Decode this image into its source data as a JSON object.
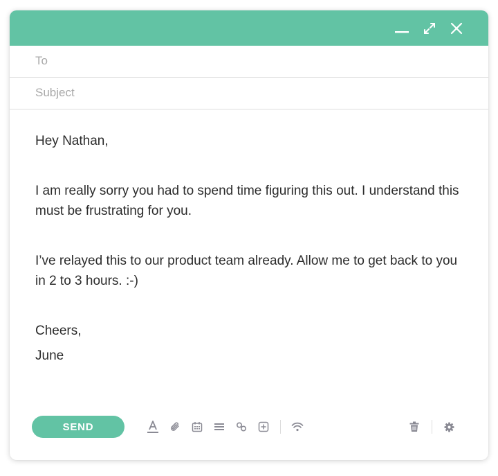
{
  "compose": {
    "to_placeholder": "To",
    "subject_placeholder": "Subject",
    "body": {
      "greeting": "Hey Nathan,",
      "paragraph_1": "I am really sorry you had to spend time figuring this out. I understand this must be frustrating for you.",
      "paragraph_2": "I’ve relayed this to our product team already. Allow me to get back to you in 2 to 3 hours. :-)",
      "signoff": "Cheers,",
      "signature": "June"
    }
  },
  "toolbar": {
    "send_label": "SEND",
    "icons": [
      "text-format-icon",
      "attachment-icon",
      "calendar-icon",
      "list-icon",
      "link-icon",
      "insert-icon",
      "signal-icon",
      "trash-icon",
      "gear-icon"
    ]
  },
  "window_controls": [
    "minimize-icon",
    "maximize-icon",
    "close-icon"
  ],
  "colors": {
    "accent": "#62c3a4",
    "icon": "#8a8a94"
  }
}
